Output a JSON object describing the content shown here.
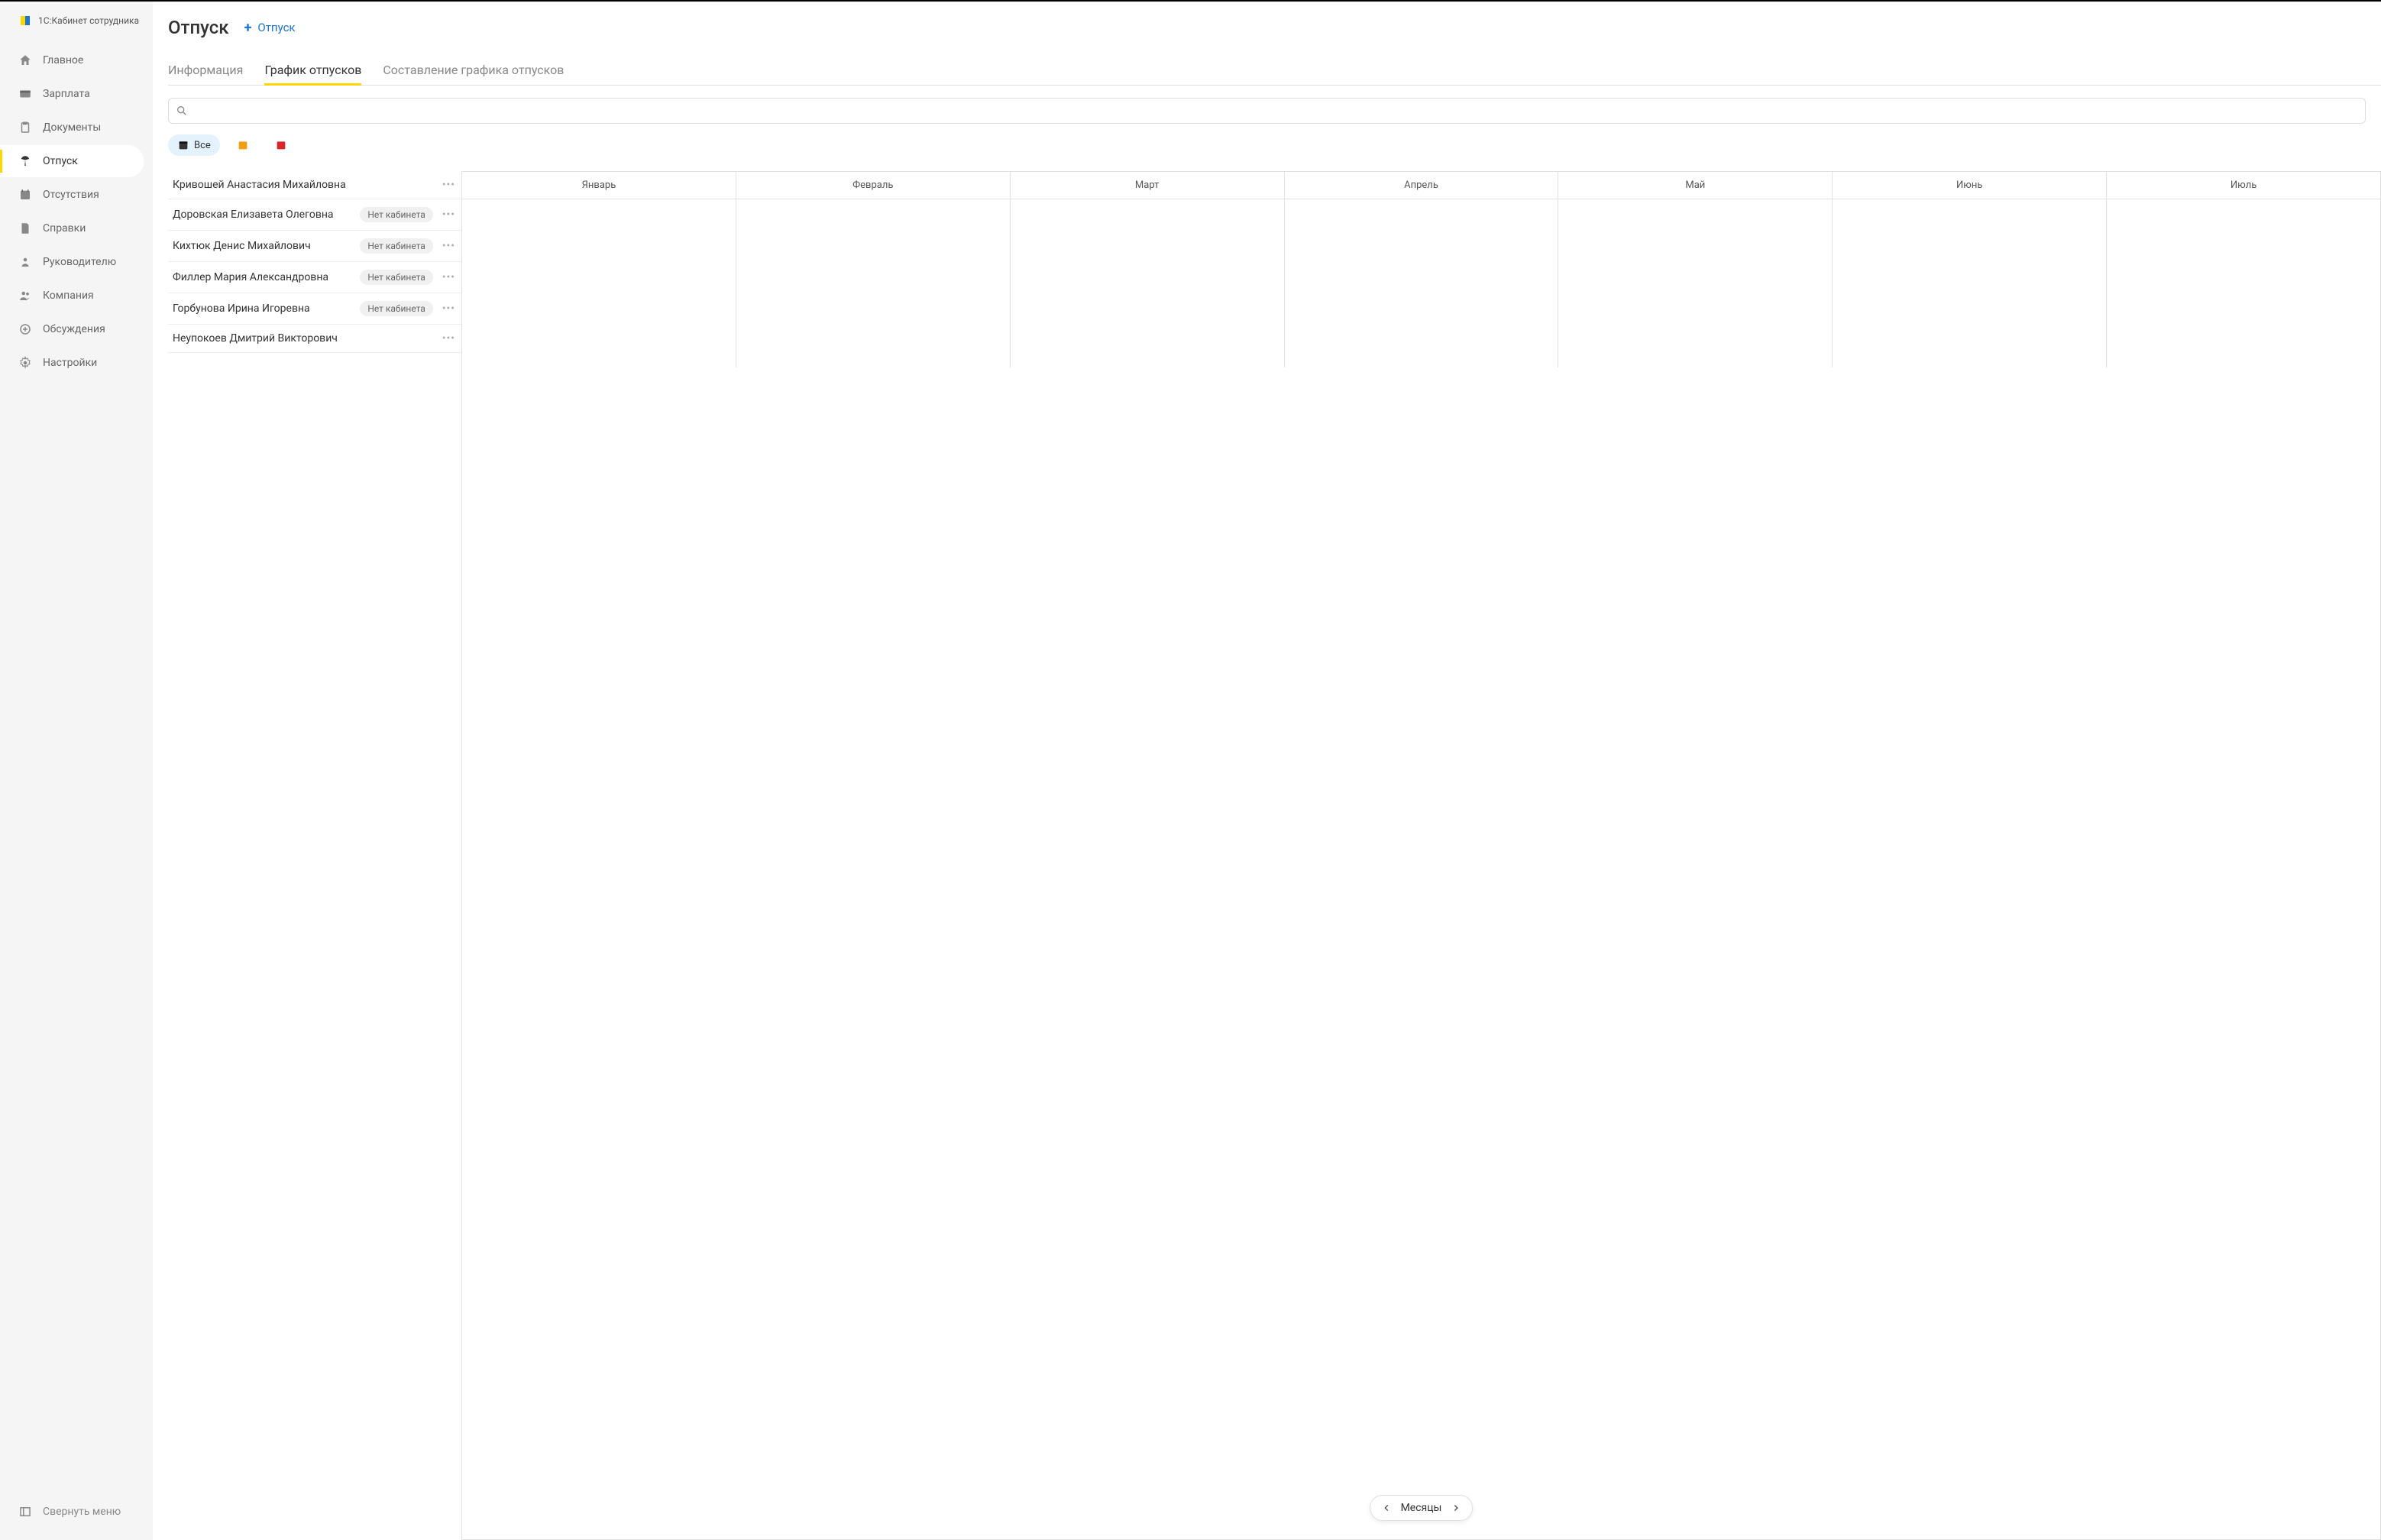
{
  "app_title": "1С:Кабинет сотрудника",
  "sidebar": {
    "items": [
      {
        "label": "Главное"
      },
      {
        "label": "Зарплата"
      },
      {
        "label": "Документы"
      },
      {
        "label": "Отпуск"
      },
      {
        "label": "Отсутствия"
      },
      {
        "label": "Справки"
      },
      {
        "label": "Руководителю"
      },
      {
        "label": "Компания"
      },
      {
        "label": "Обсуждения"
      },
      {
        "label": "Настройки"
      }
    ],
    "collapse": "Свернуть меню"
  },
  "header": {
    "title": "Отпуск",
    "add_label": "Отпуск"
  },
  "tabs": [
    {
      "label": "Информация"
    },
    {
      "label": "График отпусков"
    },
    {
      "label": "Составление графика отпусков"
    }
  ],
  "search": {
    "placeholder": ""
  },
  "filters": {
    "all_label": "Все"
  },
  "employees": [
    {
      "name": "Кривошей Анастасия Михайловна",
      "badge": null
    },
    {
      "name": "Доровская Елизавета Олеговна",
      "badge": "Нет кабинета"
    },
    {
      "name": "Кихтюк Денис Михайлович",
      "badge": "Нет кабинета"
    },
    {
      "name": "Филлер Мария Александровна",
      "badge": "Нет кабинета"
    },
    {
      "name": "Горбунова Ирина Игоревна",
      "badge": "Нет кабинета"
    },
    {
      "name": "Неупокоев Дмитрий Викторович",
      "badge": null
    }
  ],
  "calendar": {
    "months": [
      "Январь",
      "Февраль",
      "Март",
      "Апрель",
      "Май",
      "Июнь",
      "Июль"
    ],
    "nav_label": "Месяцы"
  }
}
